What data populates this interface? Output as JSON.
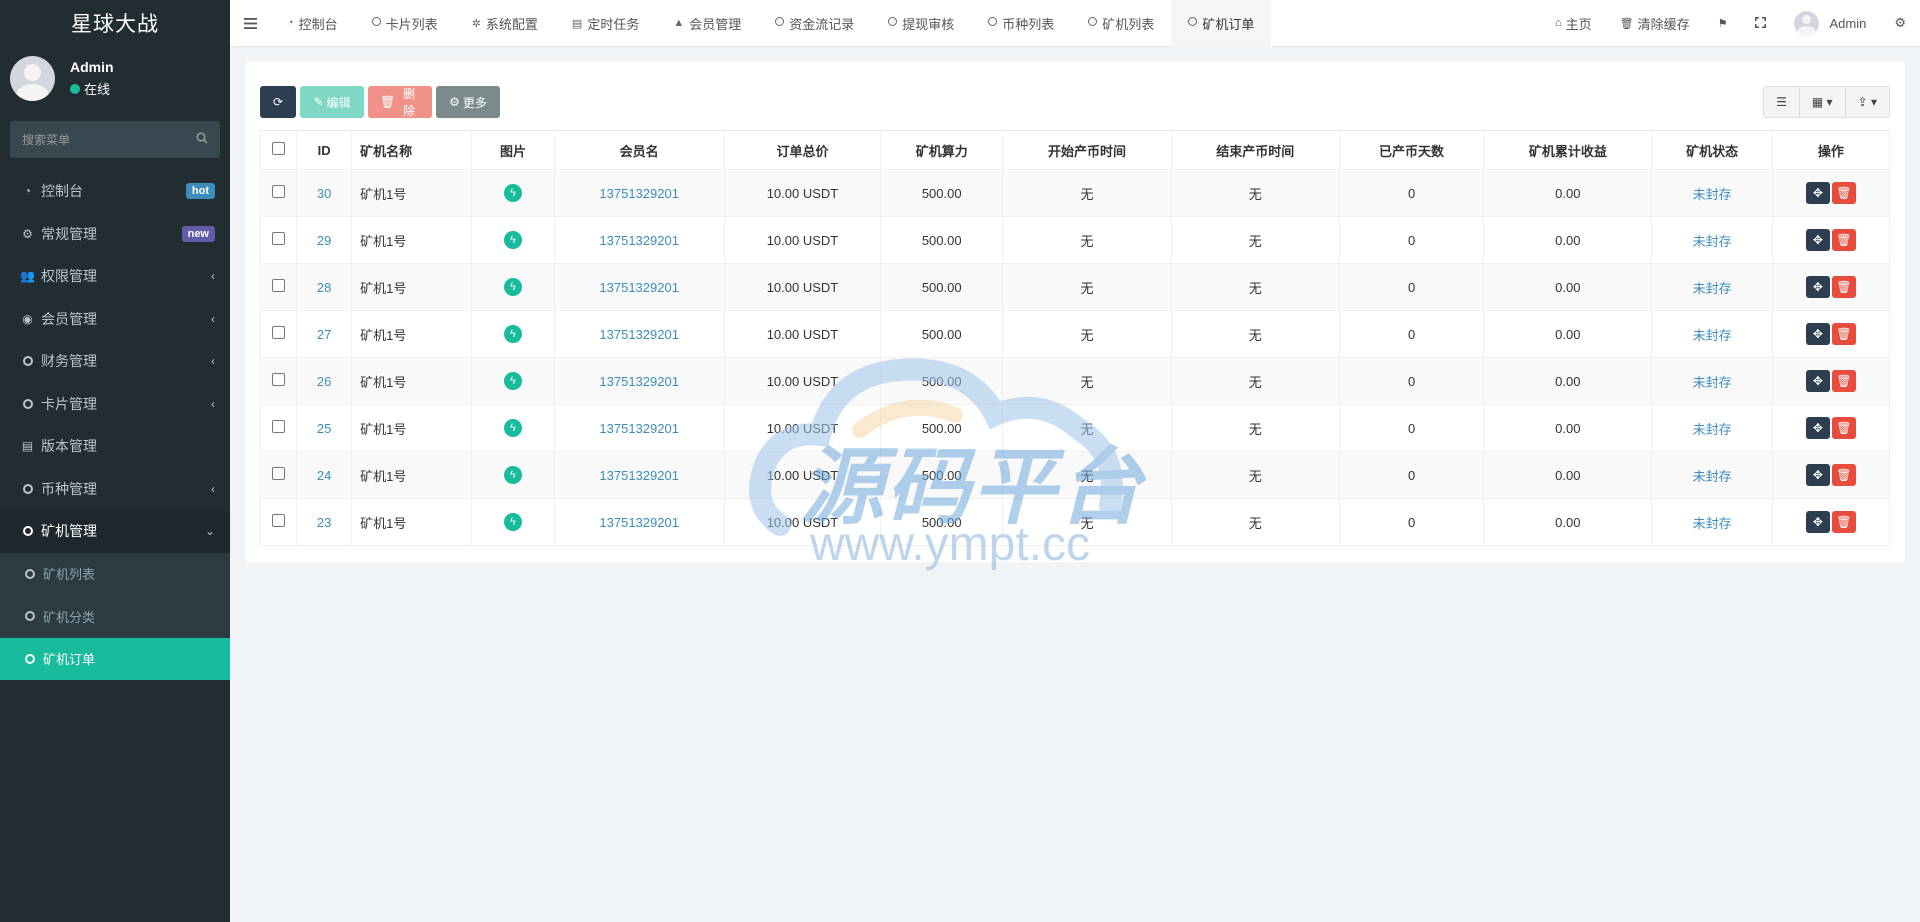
{
  "sidebar": {
    "logo": "星球大战",
    "user": {
      "name": "Admin",
      "status": "在线"
    },
    "search_placeholder": "搜索菜单",
    "items": [
      {
        "label": "控制台",
        "icon": "dashboard-icon",
        "badge": "hot"
      },
      {
        "label": "常规管理",
        "icon": "cogs-icon",
        "badge": "new"
      },
      {
        "label": "权限管理",
        "icon": "group-icon",
        "chevron": true
      },
      {
        "label": "会员管理",
        "icon": "user-circle-icon",
        "chevron": true
      },
      {
        "label": "财务管理",
        "icon": "circle-icon",
        "chevron": true
      },
      {
        "label": "卡片管理",
        "icon": "circle-icon",
        "chevron": true
      },
      {
        "label": "版本管理",
        "icon": "file-icon"
      },
      {
        "label": "币种管理",
        "icon": "circle-icon",
        "chevron": true
      },
      {
        "label": "矿机管理",
        "icon": "circle-icon",
        "open": true
      }
    ],
    "submenu": [
      {
        "label": "矿机列表"
      },
      {
        "label": "矿机分类"
      },
      {
        "label": "矿机订单",
        "active": true
      }
    ]
  },
  "topnav": {
    "tabs": [
      {
        "label": "控制台",
        "icon": "dashboard-icon"
      },
      {
        "label": "卡片列表",
        "icon": "circle-icon"
      },
      {
        "label": "系统配置",
        "icon": "gear-icon"
      },
      {
        "label": "定时任务",
        "icon": "tasks-icon"
      },
      {
        "label": "会员管理",
        "icon": "user-icon"
      },
      {
        "label": "资金流记录",
        "icon": "circle-icon"
      },
      {
        "label": "提现审核",
        "icon": "circle-icon"
      },
      {
        "label": "币种列表",
        "icon": "circle-icon"
      },
      {
        "label": "矿机列表",
        "icon": "circle-icon"
      },
      {
        "label": "矿机订单",
        "icon": "circle-icon",
        "active": true
      }
    ],
    "home": "主页",
    "clear_cache": "清除缓存",
    "user": "Admin"
  },
  "toolbar": {
    "edit": "编辑",
    "delete": "删除",
    "more": "更多"
  },
  "table": {
    "headers": [
      "ID",
      "矿机名称",
      "图片",
      "会员名",
      "订单总价",
      "矿机算力",
      "开始产币时间",
      "结束产币时间",
      "已产币天数",
      "矿机累计收益",
      "矿机状态",
      "操作"
    ],
    "rows": [
      {
        "id": "30",
        "name": "矿机1号",
        "member": "13751329201",
        "price": "10.00 USDT",
        "power": "500.00",
        "start": "无",
        "end": "无",
        "days": "0",
        "earnings": "0.00",
        "status": "未封存"
      },
      {
        "id": "29",
        "name": "矿机1号",
        "member": "13751329201",
        "price": "10.00 USDT",
        "power": "500.00",
        "start": "无",
        "end": "无",
        "days": "0",
        "earnings": "0.00",
        "status": "未封存"
      },
      {
        "id": "28",
        "name": "矿机1号",
        "member": "13751329201",
        "price": "10.00 USDT",
        "power": "500.00",
        "start": "无",
        "end": "无",
        "days": "0",
        "earnings": "0.00",
        "status": "未封存"
      },
      {
        "id": "27",
        "name": "矿机1号",
        "member": "13751329201",
        "price": "10.00 USDT",
        "power": "500.00",
        "start": "无",
        "end": "无",
        "days": "0",
        "earnings": "0.00",
        "status": "未封存"
      },
      {
        "id": "26",
        "name": "矿机1号",
        "member": "13751329201",
        "price": "10.00 USDT",
        "power": "500.00",
        "start": "无",
        "end": "无",
        "days": "0",
        "earnings": "0.00",
        "status": "未封存"
      },
      {
        "id": "25",
        "name": "矿机1号",
        "member": "13751329201",
        "price": "10.00 USDT",
        "power": "500.00",
        "start": "无",
        "end": "无",
        "days": "0",
        "earnings": "0.00",
        "status": "未封存"
      },
      {
        "id": "24",
        "name": "矿机1号",
        "member": "13751329201",
        "price": "10.00 USDT",
        "power": "500.00",
        "start": "无",
        "end": "无",
        "days": "0",
        "earnings": "0.00",
        "status": "未封存"
      },
      {
        "id": "23",
        "name": "矿机1号",
        "member": "13751329201",
        "price": "10.00 USDT",
        "power": "500.00",
        "start": "无",
        "end": "无",
        "days": "0",
        "earnings": "0.00",
        "status": "未封存"
      }
    ]
  },
  "watermark": {
    "text": "源码平台",
    "url": "www.ympt.cc"
  },
  "colors": {
    "sidebar": "#222d32",
    "accent": "#18bc9c",
    "link": "#3c8dbc",
    "danger": "#e74c3c",
    "dark": "#2c3e50"
  }
}
